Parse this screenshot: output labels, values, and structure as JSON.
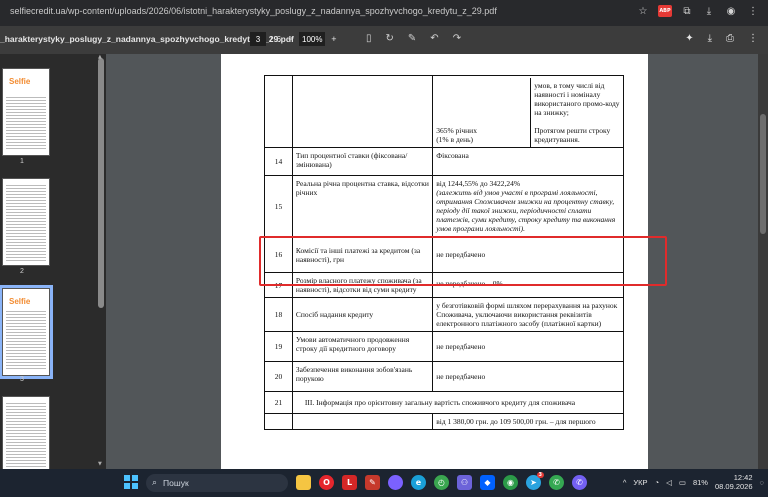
{
  "browser": {
    "url": "selfiecredit.ua/wp-content/uploads/2026/06/istotni_harakterystyky_poslugy_z_nadannya_spozhyvchogo_kredytu_z_29.pdf",
    "icons": [
      "star-icon",
      "adblock-icon",
      "puzzle-icon",
      "download-icon",
      "account-icon",
      "menu-icon"
    ],
    "adblock_label": "ABP"
  },
  "pdf": {
    "filename": "_harakterystyky_poslugy_z_nadannya_spozhyvchogo_kredytu_z_29.pdf",
    "current_page": "3",
    "page_sep": "/",
    "total_pages": "6",
    "zoom": "100%",
    "zoom_minus": "−",
    "zoom_plus": "+"
  },
  "thumbnails": [
    {
      "num": "1",
      "logo": "Selfie"
    },
    {
      "num": "2"
    },
    {
      "num": "3",
      "logo": "Selfie",
      "active": true
    },
    {
      "num": ""
    }
  ],
  "table": {
    "top_row": {
      "left_text": "365% річних\n(1% в день)",
      "right_text": "умов, в тому числі від наявності і номіналу використаного промо-коду на знижку;\n\nПротягом решти строку кредитування."
    },
    "rows": [
      {
        "num": "14",
        "name": "Тип процентної ставки (фіксована/змінювана)",
        "value": "Фіксована"
      },
      {
        "num": "15",
        "name": "Реальна річна процентна ставка, відсотки річних",
        "value": "від 1244,55% до 3422,24%",
        "note": "(залежить від умов участі в програмі лояльності, отримання Споживачем знижки на процентну ставку, періоду дії такої знижки, періодичності сплати платежів, суми кредиту, строку кредиту та виконання умов програми лояльності)."
      },
      {
        "num": "16",
        "name": "Комісії та інші платежі за кредитом (за наявності), грн",
        "value": "не передбачено"
      },
      {
        "num": "17",
        "name": "Розмір власного платежу споживача (за наявності), відсотки від суми кредиту",
        "value": "не передбачено – 0%"
      },
      {
        "num": "18",
        "name": "Спосіб надання кредиту",
        "value": "у безготівковій формі шляхом перерахування на рахунок Споживача, уключаючи використання реквізитів електронного платіжного засобу (платіжної картки)"
      },
      {
        "num": "19",
        "name": "Умови автоматичного продовження строку дії кредитного договору",
        "value": "не передбачено"
      },
      {
        "num": "20",
        "name": "Забезпечення виконання зобов'язань порукою",
        "value": "не передбачено"
      }
    ],
    "section_num": "21",
    "section_title": "ІІІ. Інформація про орієнтовну загальну вартість споживчого кредиту для споживача",
    "last_partial": "від 1 380,00 грн. до 109 500,00 грн. – для першого"
  },
  "taskbar": {
    "search_placeholder": "Пошук",
    "pinned": [
      {
        "name": "file-explorer-icon",
        "color": "#f5c542"
      },
      {
        "name": "opera-icon",
        "color": "#e5262d"
      },
      {
        "name": "red-app-icon",
        "color": "#d42727"
      },
      {
        "name": "lightshot-icon",
        "color": "#c6392c"
      },
      {
        "name": "copilot-icon",
        "color": "#7b61ff"
      },
      {
        "name": "edge-icon",
        "color": "#1aa0d8"
      },
      {
        "name": "green-app-icon",
        "color": "#3aa650"
      },
      {
        "name": "people-app-icon",
        "color": "#6c63d9"
      },
      {
        "name": "dropbox-icon",
        "color": "#0061ff"
      },
      {
        "name": "chrome-icon",
        "color": "#2b9a48"
      },
      {
        "name": "telegram-icon",
        "color": "#2aa3df"
      },
      {
        "name": "viber-green-icon",
        "color": "#35a852"
      },
      {
        "name": "viber-icon",
        "color": "#7360f2"
      }
    ],
    "telegram_badge": "3",
    "tray": {
      "lang": "УКР",
      "battery": "81%",
      "time": "12:42",
      "date": "08.09.2026"
    }
  }
}
